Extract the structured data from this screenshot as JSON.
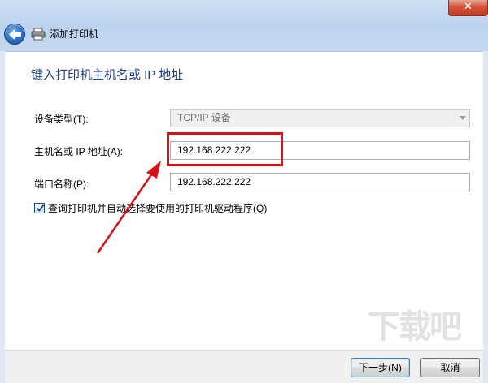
{
  "window": {
    "title": "添加打印机",
    "close_glyph": "✕"
  },
  "heading": "键入打印机主机名或 IP 地址",
  "form": {
    "device_type_label": "设备类型(T):",
    "device_type_value": "TCP/IP 设备",
    "hostname_label": "主机名或 IP 地址(A):",
    "hostname_value": "192.168.222.222",
    "port_label": "端口名称(P):",
    "port_value": "192.168.222.222",
    "query_checkbox_label": "查询打印机并自动选择要使用的打印机驱动程序(Q)",
    "query_checkbox_checked": true
  },
  "buttons": {
    "next_label": "下一步(N)",
    "cancel_label": "取消"
  },
  "annotations": {
    "highlight_color": "#d90f15",
    "arrow_color": "#d90f15"
  },
  "watermark": "下载吧",
  "icons": {
    "back": "back-arrow-icon",
    "printer": "printer-icon",
    "close": "close-icon",
    "dropdown": "chevron-down-icon",
    "check": "checkmark-icon"
  }
}
